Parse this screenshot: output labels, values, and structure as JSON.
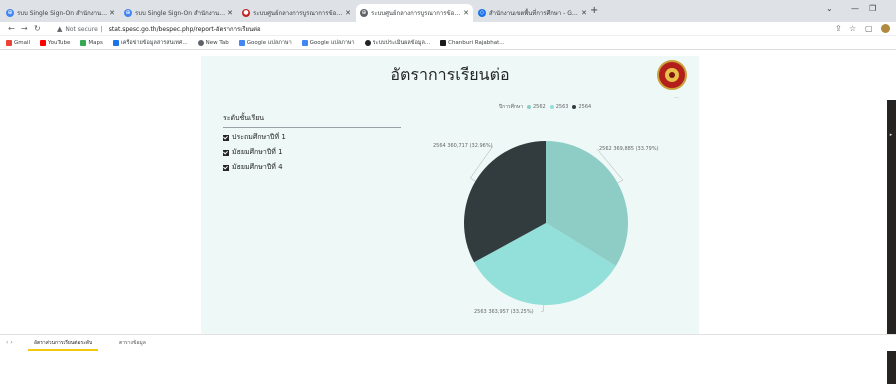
{
  "browser": {
    "tabs": [
      {
        "title": "รบบ Single Sign-On สำนักงานเขต",
        "active": false,
        "icon_color": "#4285f4"
      },
      {
        "title": "รบบ Single Sign-On สำนักงานเขต",
        "active": false,
        "icon_color": "#4285f4"
      },
      {
        "title": "ระบบศูนย์กลางการบูรณาการข้อมูลการ",
        "active": false,
        "icon_color": "#c5221f"
      },
      {
        "title": "ระบบศูนย์กลางการบูรณาการข้อมูลรายงาน",
        "active": true,
        "icon_color": "#5f6368"
      },
      {
        "title": "สำนักงานเขตพื้นที่การศึกษา - Goo",
        "active": false,
        "icon_color": "#1a73e8"
      }
    ],
    "new_tab": "+",
    "url_warning": "Not secure",
    "url": "stat.spesc.go.th/bespec.php/report-อัตราการเรียนต่อ",
    "bookmarks": [
      {
        "label": "Gmail",
        "color": "#ea4335"
      },
      {
        "label": "YouTube",
        "color": "#ff0000"
      },
      {
        "label": "Maps",
        "color": "#34a853"
      },
      {
        "label": "เครือข่ายข้อมูลสารสนเทศ...",
        "color": "#1a73e8"
      },
      {
        "label": "New Tab",
        "color": "#5f6368"
      },
      {
        "label": "Google แปลภาษา",
        "color": "#4285f4"
      },
      {
        "label": "Google แปลภาษา",
        "color": "#4285f4"
      },
      {
        "label": "ระบบประเมินผลข้อมูล...",
        "color": "#202124"
      },
      {
        "label": "Chanburi Rajabhat...",
        "color": "#1a1a1a"
      }
    ]
  },
  "report": {
    "title": "อัตราการเรียนต่อ",
    "slicer": {
      "header": "ระดับชั้นเรียน",
      "items": [
        "ประถมศึกษาปีที่ 1",
        "มัธยมศึกษาปีที่ 1",
        "มัธยมศึกษาปีที่ 4"
      ]
    },
    "legend_title": "ปีการศึกษา",
    "chart_data": {
      "type": "pie",
      "title": "",
      "legend": "top",
      "slices": [
        {
          "name": "2562",
          "value": 369885,
          "label": "2562 369,885 (33.79%)",
          "color": "#8ecdc6"
        },
        {
          "name": "2563",
          "value": 363957,
          "label": "2563 363,957 (33.25%)",
          "color": "#92e0d9"
        },
        {
          "name": "2564",
          "value": 360717,
          "label": "2564 360,717 (32.96%)",
          "color": "#323b3d"
        }
      ]
    }
  },
  "pages": {
    "tabs": [
      {
        "label": "อัตราส่วนการเรียนต่อระดับ",
        "active": true
      },
      {
        "label": "ตารางข้อมูล",
        "active": false
      }
    ]
  }
}
